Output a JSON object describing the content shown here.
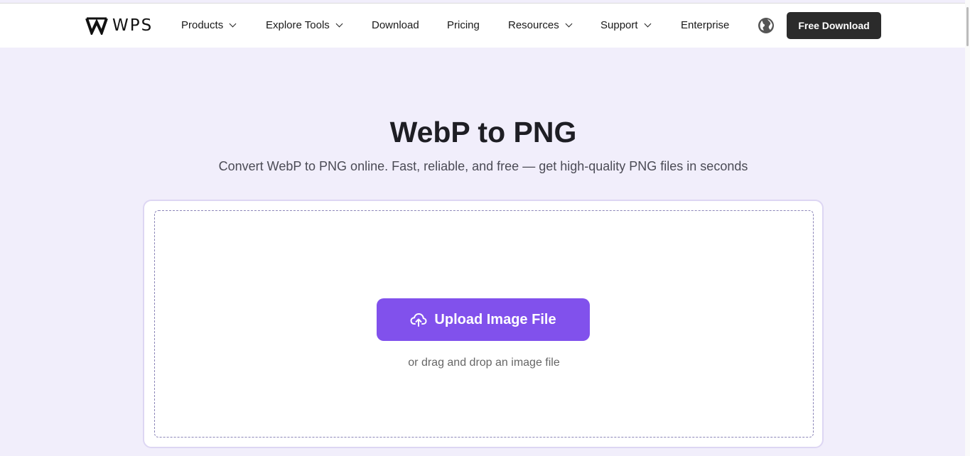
{
  "brand": {
    "logo_text": "WPS"
  },
  "nav": {
    "items": [
      {
        "label": "Products",
        "has_dropdown": true
      },
      {
        "label": "Explore Tools",
        "has_dropdown": true
      },
      {
        "label": "Download",
        "has_dropdown": false
      },
      {
        "label": "Pricing",
        "has_dropdown": false
      },
      {
        "label": "Resources",
        "has_dropdown": true
      },
      {
        "label": "Support",
        "has_dropdown": true
      },
      {
        "label": "Enterprise",
        "has_dropdown": false
      }
    ],
    "language_icon": "globe-icon",
    "cta_label": "Free Download"
  },
  "hero": {
    "title": "WebP to PNG",
    "subtitle": "Convert WebP to PNG online. Fast, reliable, and free — get high-quality PNG files in seconds"
  },
  "upload": {
    "button_label": "Upload Image File",
    "button_icon": "cloud-upload-icon",
    "hint": "or drag and drop an image file"
  },
  "colors": {
    "page_bg": "#f1eefb",
    "accent": "#8151ec",
    "cta_bg": "#2b2b2b"
  }
}
